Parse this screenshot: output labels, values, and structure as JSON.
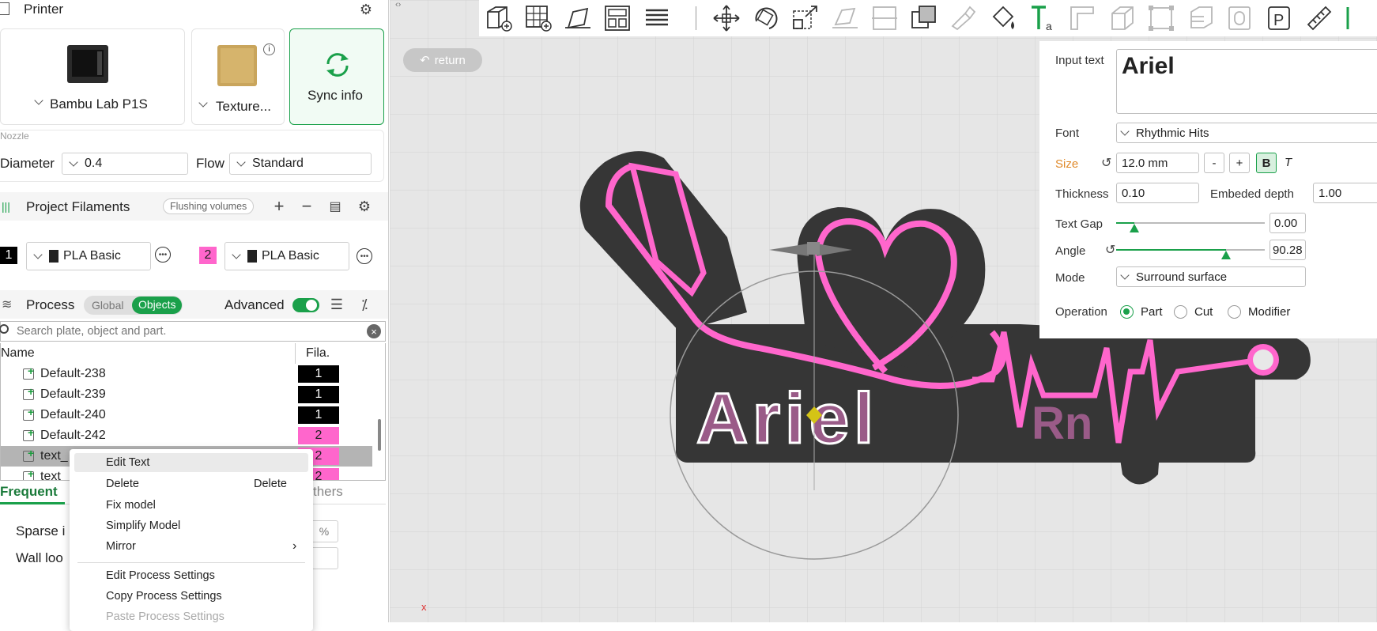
{
  "printer": {
    "title": "Printer",
    "machine_name": "Bambu Lab P1S",
    "plate_name": "Texture...",
    "sync_label": "Sync info",
    "nozzle_label": "Nozzle",
    "diameter_label": "Diameter",
    "diameter_value": "0.4",
    "flow_label": "Flow",
    "flow_value": "Standard"
  },
  "filaments": {
    "title": "Project Filaments",
    "flushing_label": "Flushing volumes",
    "items": [
      {
        "index": "1",
        "name": "PLA Basic",
        "color": "#000000"
      },
      {
        "index": "2",
        "name": "PLA Basic",
        "color": "#ff66cc"
      }
    ]
  },
  "process": {
    "title": "Process",
    "global_label": "Global",
    "objects_label": "Objects",
    "advanced_label": "Advanced",
    "search_placeholder": "Search plate, object and part."
  },
  "tree": {
    "col_name": "Name",
    "col_fila": "Fila.",
    "rows": [
      {
        "name": "Default-238",
        "fila": "1",
        "color": "#000000"
      },
      {
        "name": "Default-239",
        "fila": "1",
        "color": "#000000"
      },
      {
        "name": "Default-240",
        "fila": "1",
        "color": "#000000"
      },
      {
        "name": "Default-242",
        "fila": "2",
        "color": "#ff66cc"
      },
      {
        "name": "text_",
        "fila": "2",
        "color": "#ff66cc"
      },
      {
        "name": "text_",
        "fila": "2",
        "color": "#ff66cc"
      }
    ]
  },
  "settings_tabs": {
    "frequent": "Frequent",
    "others": "thers",
    "sparse_label": "Sparse i",
    "sparse_unit": "%",
    "wall_label": "Wall loo"
  },
  "context_menu": {
    "edit_text": "Edit Text",
    "delete": "Delete",
    "delete_shortcut": "Delete",
    "fix_model": "Fix model",
    "simplify_model": "Simplify Model",
    "mirror": "Mirror",
    "edit_process": "Edit Process Settings",
    "copy_process": "Copy Process Settings",
    "paste_process": "Paste Process Settings"
  },
  "viewport": {
    "return_label": "return",
    "model_text": "Ariel",
    "model_subtext": "Rn",
    "axis_label": "x"
  },
  "text_panel": {
    "input_label": "Input text",
    "input_value": "Ariel",
    "font_label": "Font",
    "font_value": "Rhythmic Hits",
    "size_label": "Size",
    "size_value": "12.0 mm",
    "minus": "-",
    "plus": "+",
    "bold": "B",
    "italic": "T",
    "thickness_label": "Thickness",
    "thickness_value": "0.10",
    "embeded_label": "Embeded depth",
    "embeded_value": "1.00",
    "gap_label": "Text Gap",
    "gap_value": "0.00",
    "gap_fraction": 0.12,
    "angle_label": "Angle",
    "angle_value": "90.28",
    "angle_fraction": 0.74,
    "mode_label": "Mode",
    "mode_value": "Surround surface",
    "operation_label": "Operation",
    "op_part": "Part",
    "op_cut": "Cut",
    "op_modifier": "Modifier"
  },
  "colors": {
    "accent": "#1aa04a",
    "pink": "#ff66cc",
    "model_dark": "#3a3a3a"
  }
}
